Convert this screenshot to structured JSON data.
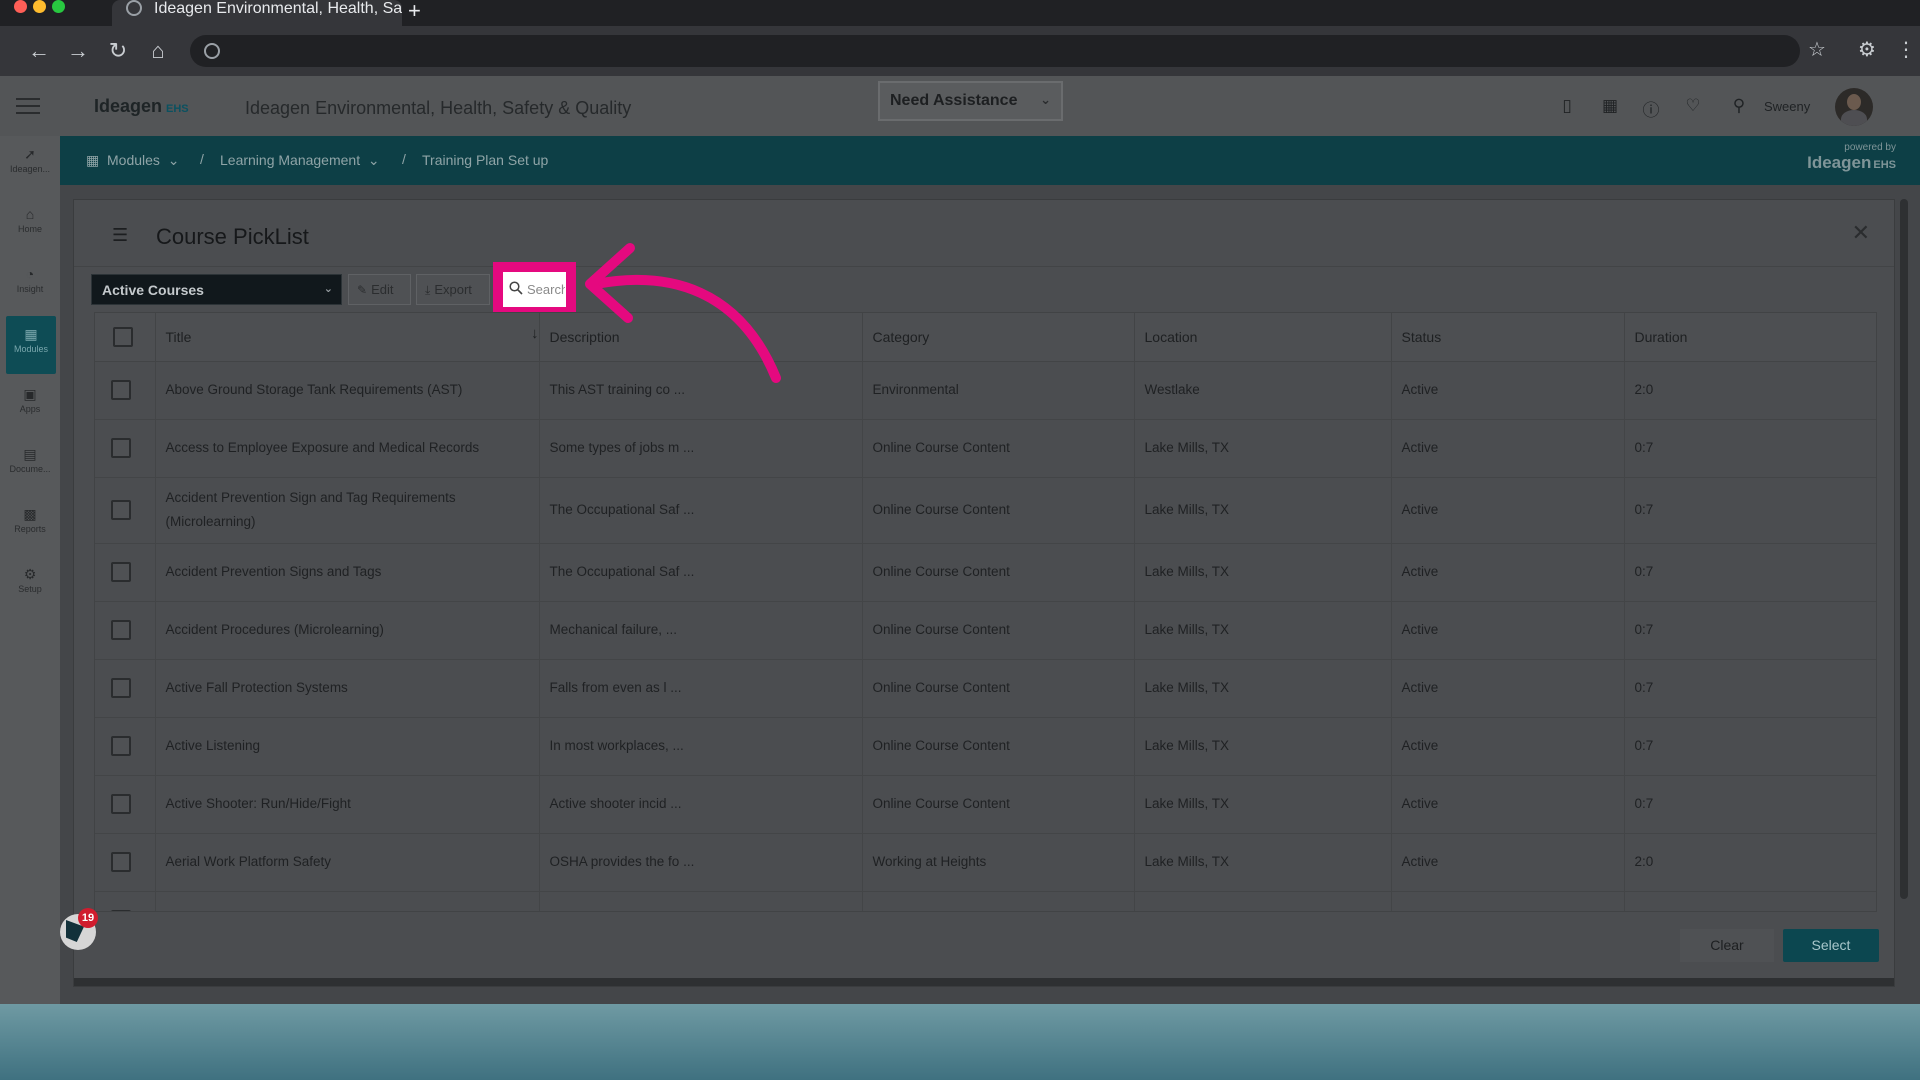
{
  "browser": {
    "tab_title": "Ideagen Environmental, Health, Sa",
    "new_tab_label": "+"
  },
  "app": {
    "brand": "Ideagen",
    "brand_suffix": "EHS",
    "title": "Ideagen Environmental, Health, Safety & Quality",
    "assistance_label": "Need Assistance",
    "user_name": "Sweeny"
  },
  "breadcrumb": {
    "items": [
      "Modules",
      "Learning Management",
      "Training Plan Set up"
    ],
    "powered_by": "powered by",
    "powered_brand": "Ideagen",
    "powered_suffix": "EHS"
  },
  "leftnav": {
    "items": [
      {
        "label": "Ideagen...",
        "icon": "ideagen-logo-icon"
      },
      {
        "label": "Home",
        "icon": "home-icon"
      },
      {
        "label": "Insight",
        "icon": "insight-icon"
      },
      {
        "label": "Modules",
        "icon": "modules-grid-icon"
      },
      {
        "label": "Apps",
        "icon": "apps-icon"
      },
      {
        "label": "Docume...",
        "icon": "document-icon"
      },
      {
        "label": "Reports",
        "icon": "reports-chart-icon"
      },
      {
        "label": "Setup",
        "icon": "gear-icon"
      }
    ]
  },
  "modal": {
    "title": "Course PickList",
    "filter_value": "Active Courses",
    "edit_label": "Edit",
    "export_label": "Export",
    "search_placeholder": "Search",
    "columns": [
      "Title",
      "Description",
      "Category",
      "Location",
      "Status",
      "Duration"
    ],
    "rows": [
      {
        "title": "Above Ground Storage Tank Requirements (AST)",
        "description": "This AST training co ...",
        "category": "Environmental",
        "location": "Westlake",
        "status": "Active",
        "duration": "2:0"
      },
      {
        "title": "Access to Employee Exposure and Medical Records",
        "description": "Some types of jobs m ...",
        "category": "Online Course Content",
        "location": "Lake Mills, TX",
        "status": "Active",
        "duration": "0:7"
      },
      {
        "title": "Accident Prevention Sign and Tag Requirements (Microlearning)",
        "description": "The Occupational Saf ...",
        "category": "Online Course Content",
        "location": "Lake Mills, TX",
        "status": "Active",
        "duration": "0:7"
      },
      {
        "title": "Accident Prevention Signs and Tags",
        "description": "The Occupational Saf ...",
        "category": "Online Course Content",
        "location": "Lake Mills, TX",
        "status": "Active",
        "duration": "0:7"
      },
      {
        "title": "Accident Procedures (Microlearning)",
        "description": "Mechanical failure, ...",
        "category": "Online Course Content",
        "location": "Lake Mills, TX",
        "status": "Active",
        "duration": "0:7"
      },
      {
        "title": "Active Fall Protection Systems",
        "description": "Falls from even as l ...",
        "category": "Online Course Content",
        "location": "Lake Mills, TX",
        "status": "Active",
        "duration": "0:7"
      },
      {
        "title": "Active Listening",
        "description": "In most workplaces, ...",
        "category": "Online Course Content",
        "location": "Lake Mills, TX",
        "status": "Active",
        "duration": "0:7"
      },
      {
        "title": "Active Shooter: Run/Hide/Fight",
        "description": "Active shooter incid ...",
        "category": "Online Course Content",
        "location": "Lake Mills, TX",
        "status": "Active",
        "duration": "0:7"
      },
      {
        "title": "Aerial Work Platform Safety",
        "description": "OSHA provides the fo ...",
        "category": "Working at Heights",
        "location": "Lake Mills, TX",
        "status": "Active",
        "duration": "2:0"
      }
    ],
    "clear_label": "Clear",
    "select_label": "Select"
  },
  "chat": {
    "badge_count": "19"
  },
  "colors": {
    "highlight": "#e5097f",
    "teal": "#0d3f46",
    "select_button": "#0c4750"
  }
}
